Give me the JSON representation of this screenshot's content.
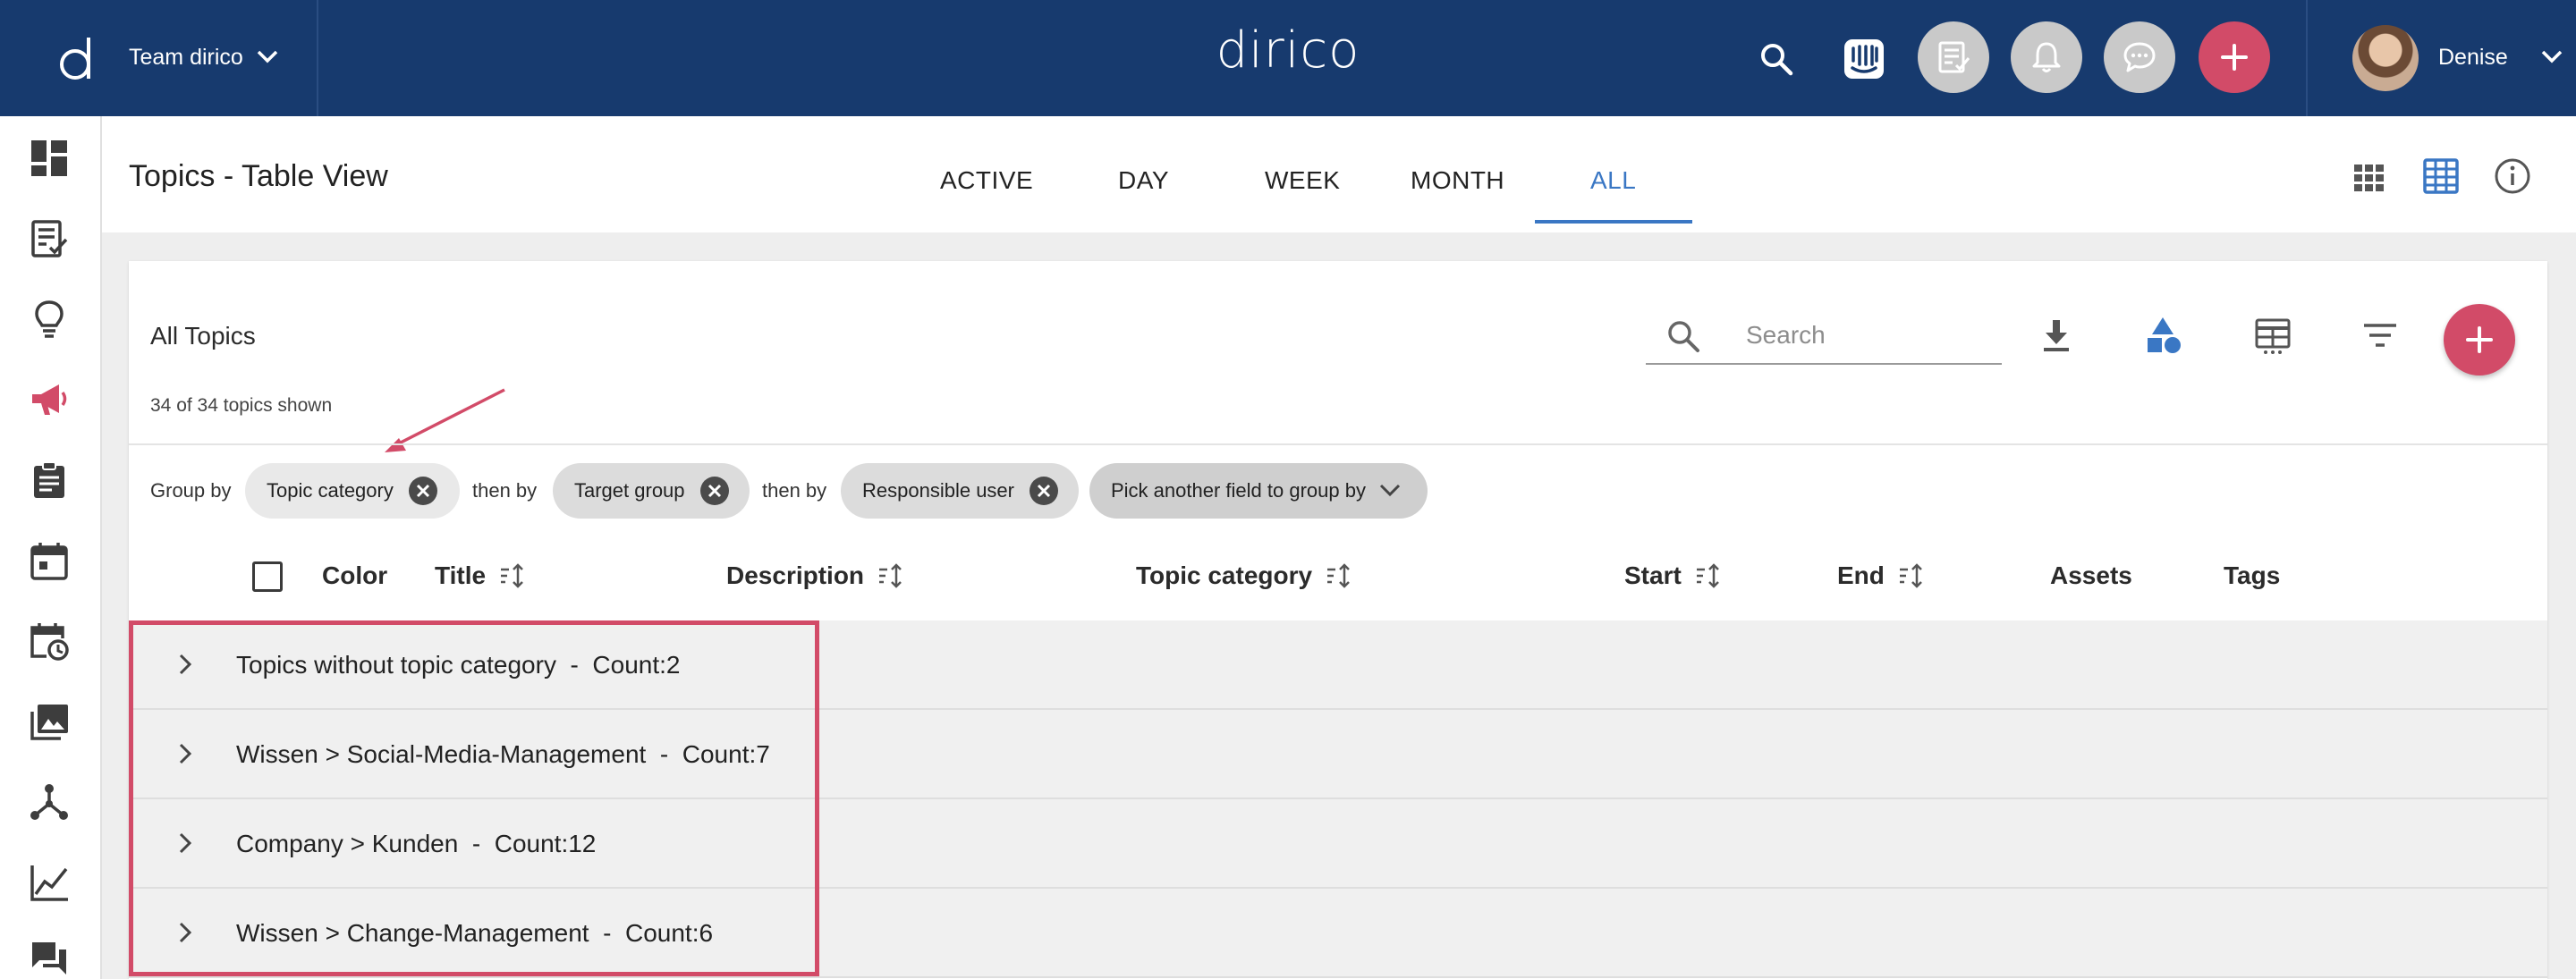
{
  "topbar": {
    "team_name": "Team dirico",
    "brand": "dirico",
    "user_name": "Denise",
    "colors": {
      "bar": "#173a6e",
      "accent": "#d24b68"
    },
    "icons": [
      "search-icon",
      "intercom-icon",
      "tasks-icon",
      "bell-icon",
      "chat-icon",
      "plus-icon"
    ]
  },
  "sidebar": {
    "items": [
      {
        "icon": "dashboard-icon"
      },
      {
        "icon": "checklist-icon"
      },
      {
        "icon": "lightbulb-icon"
      },
      {
        "icon": "megaphone-icon",
        "active": true
      },
      {
        "icon": "clipboard-icon"
      },
      {
        "icon": "calendar-icon"
      },
      {
        "icon": "calendar-clock-icon"
      },
      {
        "icon": "images-icon"
      },
      {
        "icon": "network-icon"
      },
      {
        "icon": "chart-line-icon"
      },
      {
        "icon": "forum-icon"
      }
    ]
  },
  "page": {
    "title": "Topics - Table View",
    "tabs": [
      "ACTIVE",
      "DAY",
      "WEEK",
      "MONTH",
      "ALL"
    ],
    "active_tab": "ALL"
  },
  "card": {
    "title": "All Topics",
    "shown": "34 of 34 topics shown",
    "search_placeholder": "Search",
    "group_by_label": "Group by",
    "then_by_label": "then by",
    "chips": [
      "Topic category",
      "Target group",
      "Responsible user"
    ],
    "pick_field": "Pick another field to group by"
  },
  "table": {
    "columns": [
      "Color",
      "Title",
      "Description",
      "Topic category",
      "Start",
      "End",
      "Assets",
      "Tags"
    ],
    "groups": [
      "Topics without topic category  -  Count:2",
      "Wissen > Social-Media-Management  -  Count:7",
      "Company > Kunden  -  Count:12",
      "Wissen > Change-Management  -  Count:6"
    ]
  }
}
